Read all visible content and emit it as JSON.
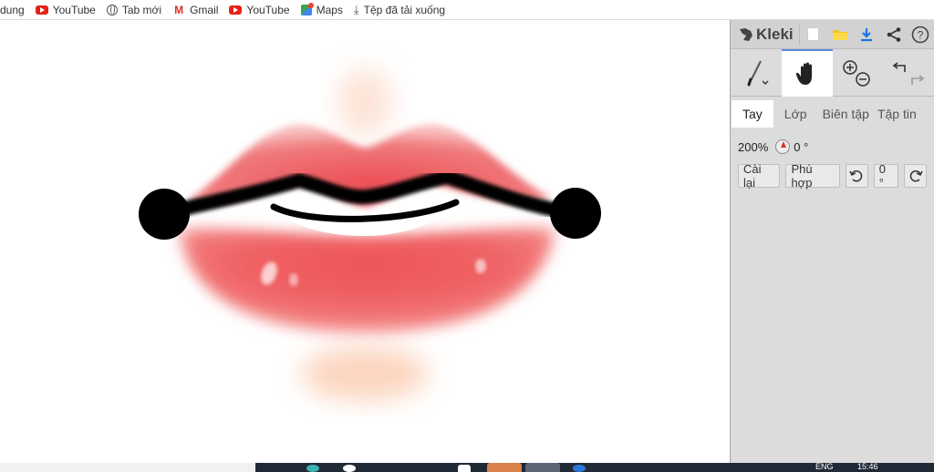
{
  "bookmarks": {
    "items": [
      {
        "label": "dung",
        "icon": "none"
      },
      {
        "label": "YouTube",
        "icon": "youtube-icon"
      },
      {
        "label": "Tab mới",
        "icon": "globe-icon"
      },
      {
        "label": "Gmail",
        "icon": "gmail-icon"
      },
      {
        "label": "YouTube",
        "icon": "youtube-icon"
      },
      {
        "label": "Maps",
        "icon": "maps-icon"
      },
      {
        "label": "Tệp đã tải xuống",
        "icon": "download-icon"
      }
    ]
  },
  "panel": {
    "logo_text": "Kleki",
    "tabs": [
      "Tay",
      "Lớp",
      "Biên tập",
      "Tập tin"
    ],
    "active_tab": "Tay",
    "zoom_value": "200%",
    "rotation_value": "0 °",
    "buttons": {
      "reset": "Cài lại",
      "fit": "Phù hợp",
      "angle": "0 °"
    }
  },
  "taskbar": {
    "lang": "ENG",
    "time": "15:46"
  },
  "colors": {
    "panel_bg": "#dcdcdc",
    "accent_blue": "#1a73e8",
    "lip_red": "#e8484e",
    "lip_pink": "#f4a0a0"
  }
}
